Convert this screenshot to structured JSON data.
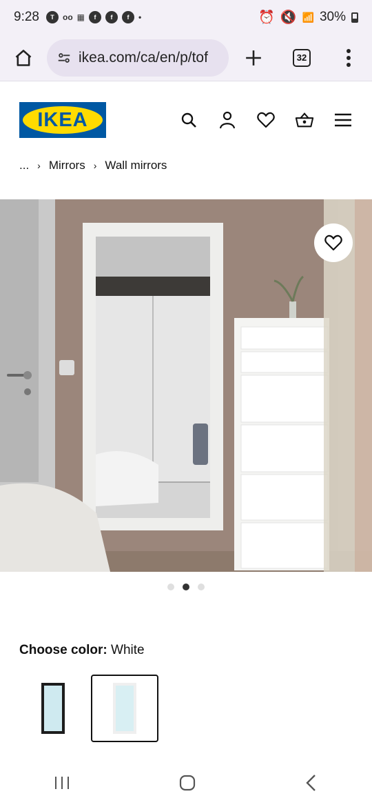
{
  "status_bar": {
    "time": "9:28",
    "notification_icons": [
      "chat-bubble-icon",
      "voicemail-icon",
      "temu-icon",
      "facebook-icon",
      "facebook-icon",
      "facebook-icon",
      "dot-icon"
    ],
    "battery": "30%"
  },
  "browser": {
    "url": "ikea.com/ca/en/p/tof",
    "tab_count": "32"
  },
  "site": {
    "logo_text": "IKEA",
    "brand_blue": "#0058a3",
    "brand_yellow": "#ffdb00",
    "nav_icons": [
      "search-icon",
      "account-icon",
      "wishlist-icon",
      "cart-icon",
      "menu-icon"
    ]
  },
  "breadcrumb": {
    "ellipsis": "...",
    "items": [
      "Mirrors",
      "Wall mirrors"
    ]
  },
  "gallery": {
    "image_count": 3,
    "active_index": 1
  },
  "product": {
    "choose_color_label": "Choose color:",
    "selected_color": "White",
    "swatches": [
      {
        "name": "black-mirror",
        "selected": false
      },
      {
        "name": "white-mirror",
        "selected": true
      }
    ]
  }
}
